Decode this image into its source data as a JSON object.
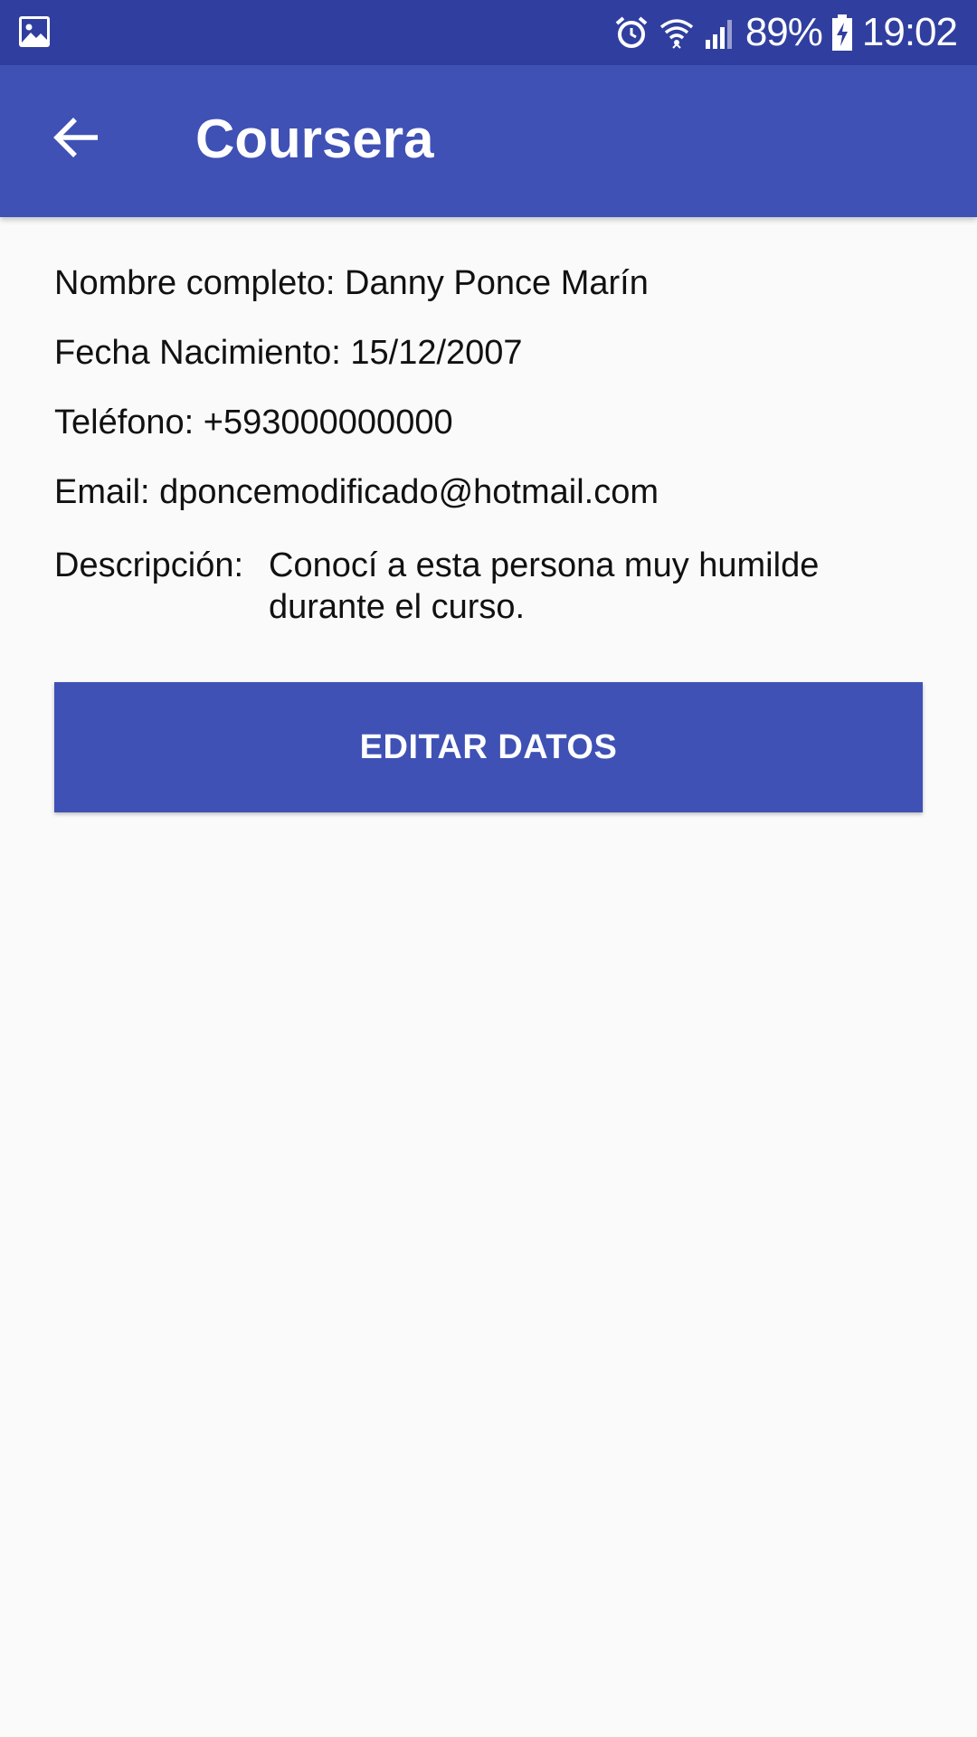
{
  "status_bar": {
    "left_icon": "image-icon",
    "icons": [
      "alarm-icon",
      "wifi-icon",
      "signal-icon"
    ],
    "battery_percent": "89%",
    "time": "19:02"
  },
  "app_bar": {
    "back_icon": "arrow-back-icon",
    "title": "Coursera"
  },
  "contact": {
    "name_label": "Nombre completo:",
    "name_value": "Danny Ponce Marín",
    "birth_label": "Fecha Nacimiento:",
    "birth_value": "15/12/2007",
    "phone_label": "Teléfono:",
    "phone_value": "+593000000000",
    "email_label": "Email:",
    "email_value": "dponcemodificado@hotmail.com",
    "description_label": "Descripción:",
    "description_value": "Conocí a esta persona muy humilde durante el curso."
  },
  "actions": {
    "edit_label": "EDITAR DATOS"
  },
  "colors": {
    "status_bar": "#303f9f",
    "primary": "#3f51b5",
    "background": "#fafafa"
  }
}
